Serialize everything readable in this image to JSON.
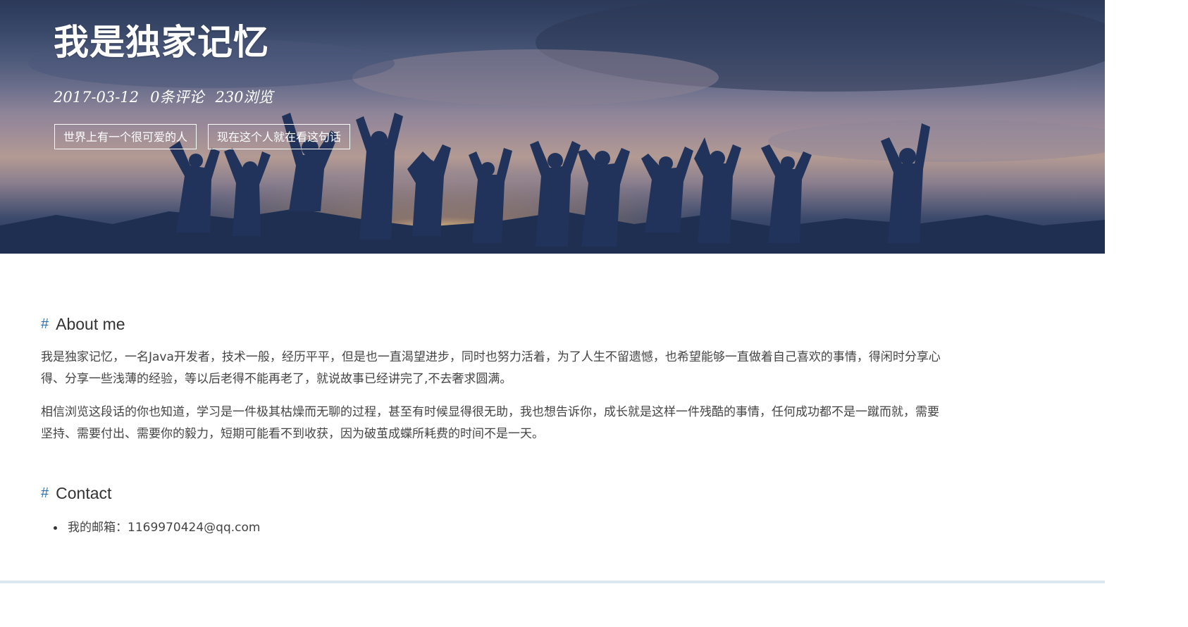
{
  "hero": {
    "title": "我是独家记忆",
    "date": "2017-03-12",
    "comments": "0条评论",
    "views": "230浏览",
    "tags": [
      "世界上有一个很可爱的人",
      "现在这个人就在看这句话"
    ]
  },
  "about": {
    "hash": "#",
    "title": "About me",
    "paragraphs": [
      "我是独家记忆，一名Java开发者，技术一般，经历平平，但是也一直渴望进步，同时也努力活着，为了人生不留遗憾，也希望能够一直做着自己喜欢的事情，得闲时分享心得、分享一些浅薄的经验，等以后老得不能再老了，就说故事已经讲完了,不去奢求圆满。",
      "相信浏览这段话的你也知道，学习是一件极其枯燥而无聊的过程，甚至有时候显得很无助，我也想告诉你，成长就是这样一件残酷的事情，任何成功都不是一蹴而就，需要坚持、需要付出、需要你的毅力，短期可能看不到收获，因为破茧成蝶所耗费的时间不是一天。"
    ]
  },
  "contact": {
    "hash": "#",
    "title": "Contact",
    "items": [
      "我的邮箱：1169970424@qq.com"
    ]
  },
  "colors": {
    "accent": "#2f6ea8",
    "text": "#333333"
  }
}
